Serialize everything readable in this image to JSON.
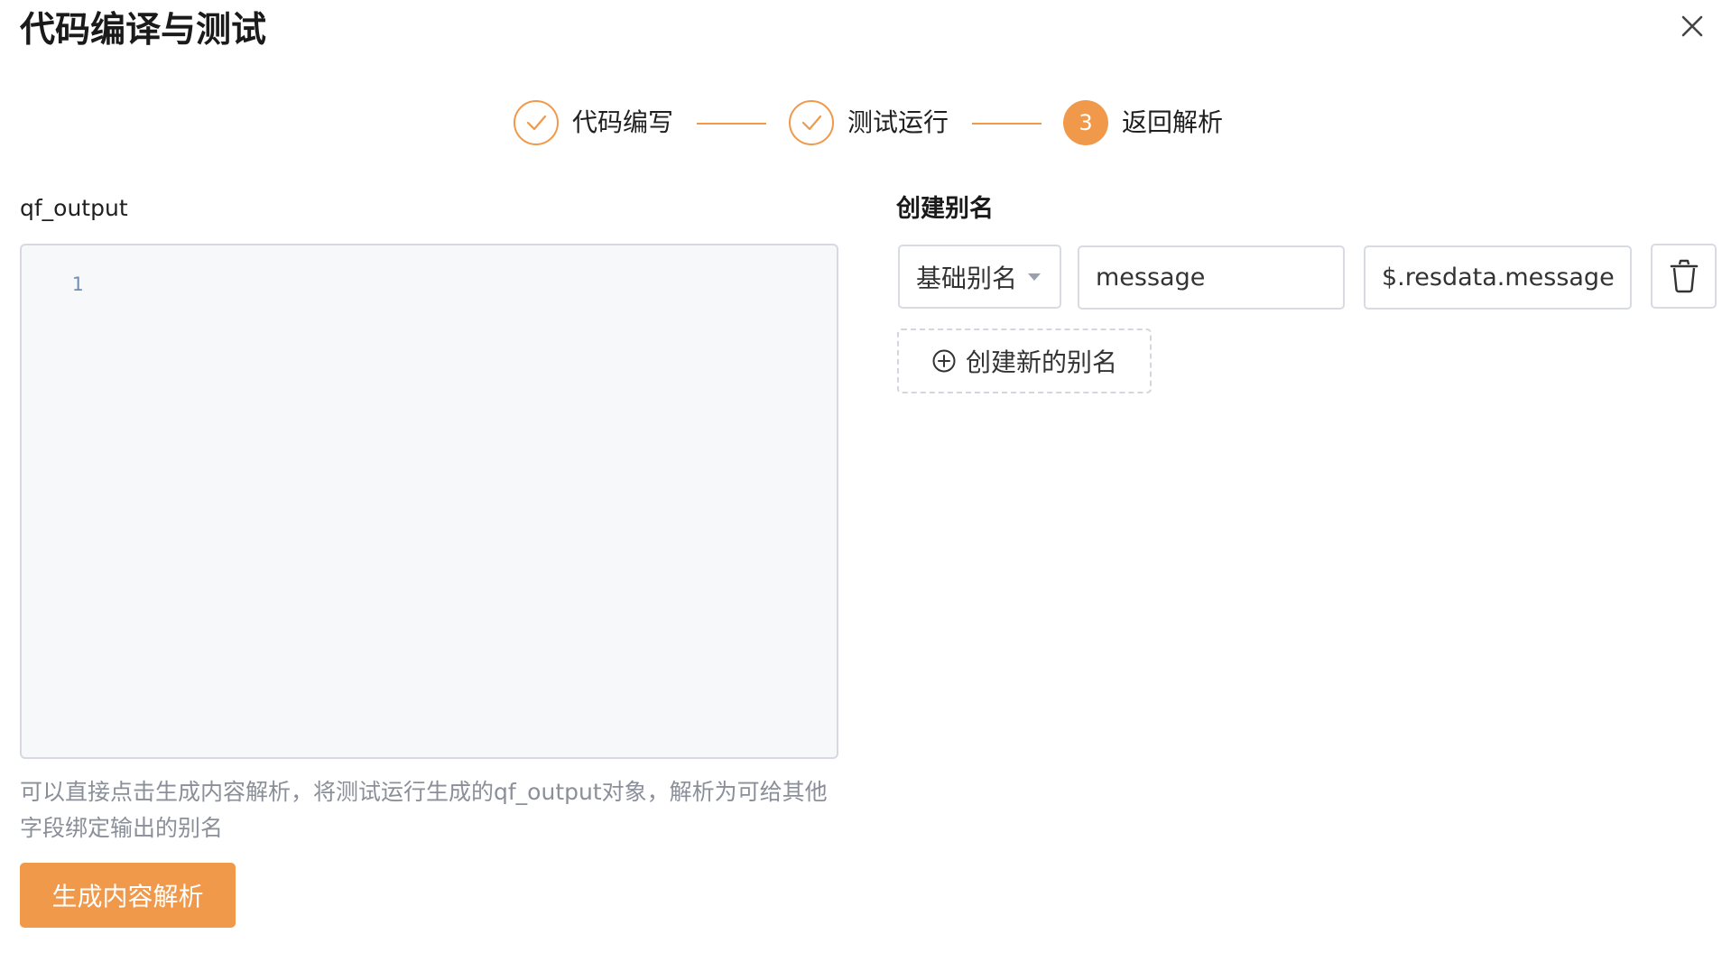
{
  "dialog": {
    "title": "代码编译与测试",
    "close_icon": "close-icon"
  },
  "steps": [
    {
      "label": "代码编写",
      "status": "done",
      "icon": "check-icon"
    },
    {
      "label": "测试运行",
      "status": "done",
      "icon": "check-icon"
    },
    {
      "label": "返回解析",
      "status": "active",
      "number": "3"
    }
  ],
  "left": {
    "field_label": "qf_output",
    "editor": {
      "line_numbers": [
        "1"
      ],
      "content": ""
    },
    "hint": "可以直接点击生成内容解析，将测试运行生成的qf_output对象，解析为可给其他字段绑定输出的别名",
    "generate_button": "生成内容解析"
  },
  "right": {
    "section_title": "创建别名",
    "alias_row": {
      "type_selected": "基础别名",
      "name_value": "message",
      "path_value": "$.resdata.message",
      "delete_icon": "trash-icon"
    },
    "add_button": "创建新的别名",
    "add_icon": "plus-circle-icon"
  },
  "colors": {
    "accent": "#f0994a",
    "border": "#d8dbe1",
    "editor_bg": "#f7f8fa",
    "hint_text": "#8a8f99"
  }
}
